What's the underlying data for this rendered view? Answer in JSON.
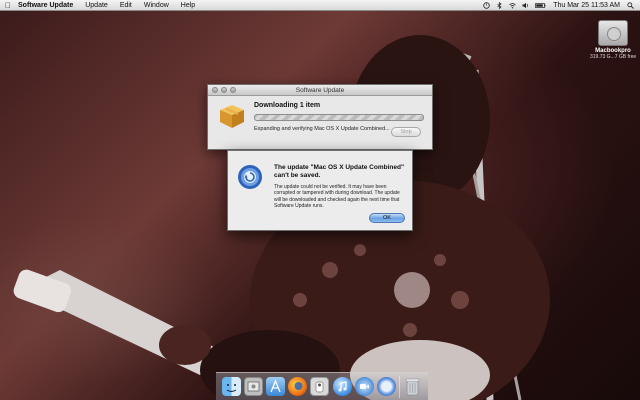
{
  "menubar": {
    "app_name": "Software Update",
    "menus": [
      "Update",
      "Edit",
      "Window",
      "Help"
    ],
    "clock": "Thu Mar 25  11:53 AM",
    "apple_icon": "apple-icon",
    "status_icons": [
      "time-machine-icon",
      "bluetooth-icon",
      "wifi-icon",
      "volume-icon",
      "battery-icon",
      "spotlight-icon"
    ]
  },
  "desktop": {
    "drive": {
      "name": "Macbookpro",
      "info": "319.73 G...7 GB free"
    }
  },
  "software_update_window": {
    "title": "Software Update",
    "heading": "Downloading 1 item",
    "status": "Expanding and verifying Mac OS X Update Combined...",
    "stop_label": "Stop"
  },
  "alert": {
    "title": "The update \"Mac OS X Update Combined\" can't be saved.",
    "message": "The update could not be verified. It may have been corrupted or tampered with during download. The update will be downloaded and checked again the next time that Software Update runs.",
    "ok_label": "OK"
  },
  "dock": {
    "items": [
      "finder-icon",
      "preview-icon",
      "app-store-icon",
      "firefox-icon",
      "iphoto-icon",
      "itunes-icon",
      "facetime-icon",
      "software-update-icon",
      "trash-icon"
    ]
  },
  "colors": {
    "accent_button": "#6aa2e3",
    "wallpaper_tone": "#6e3a36"
  }
}
